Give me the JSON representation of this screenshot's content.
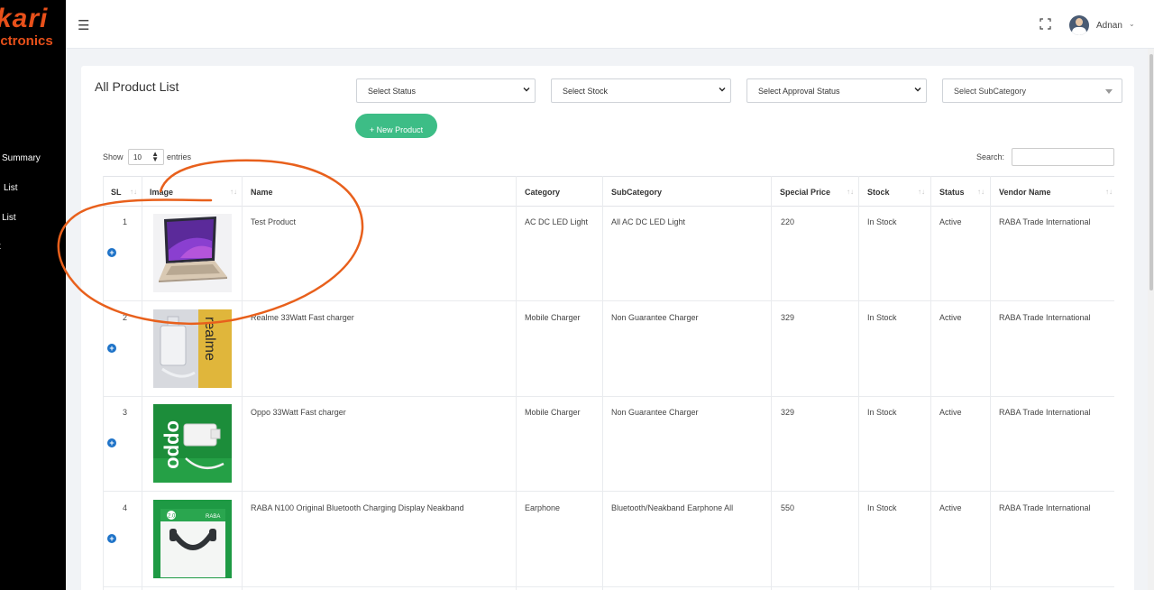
{
  "sidebar": {
    "logo_line1": "kari",
    "logo_line2": "ectronics",
    "items": [
      {
        "label": "Summary"
      },
      {
        "label": "List"
      },
      {
        "label": "r List"
      },
      {
        "label": "t"
      }
    ]
  },
  "topbar": {
    "menu_icon": "hamburger-icon",
    "fullscreen_icon": "fullscreen-icon",
    "user_name": "Adnan",
    "caret": "⌄"
  },
  "page": {
    "title": "All Product List",
    "filters": [
      {
        "label": "Select Status"
      },
      {
        "label": "Select Stock"
      },
      {
        "label": "Select Approval Status"
      },
      {
        "label": "Select SubCategory"
      }
    ],
    "new_button": "+ New Product",
    "show_label": "Show",
    "show_value": "10",
    "entries_label": "entries",
    "search_label": "Search:"
  },
  "table": {
    "headers": [
      "SL",
      "Image",
      "Name",
      "Category",
      "SubCategory",
      "Special Price",
      "Stock",
      "Status",
      "Vendor Name"
    ],
    "rows": [
      {
        "sl": "1",
        "name": "Test Product",
        "category": "AC DC LED Light",
        "subcategory": "All AC DC LED Light",
        "price": "220",
        "stock": "In Stock",
        "status": "Active",
        "vendor": "RABA Trade International",
        "image": "laptop"
      },
      {
        "sl": "2",
        "name": "Realme 33Watt Fast charger",
        "category": "Mobile Charger",
        "subcategory": "Non Guarantee Charger",
        "price": "329",
        "stock": "In Stock",
        "status": "Active",
        "vendor": "RABA Trade International",
        "image": "realme-box"
      },
      {
        "sl": "3",
        "name": "Oppo 33Watt Fast charger",
        "category": "Mobile Charger",
        "subcategory": "Non Guarantee Charger",
        "price": "329",
        "stock": "In Stock",
        "status": "Active",
        "vendor": "RABA Trade International",
        "image": "oppo-box"
      },
      {
        "sl": "4",
        "name": "RABA N100 Original Bluetooth Charging Display Neakband",
        "category": "Earphone",
        "subcategory": "Bluetooth/Neakband Earphone All",
        "price": "550",
        "stock": "In Stock",
        "status": "Active",
        "vendor": "RABA Trade International",
        "image": "neckband-box"
      }
    ]
  },
  "thumb_text": {
    "realme": "realme",
    "oppo": "oppo",
    "raba_badge": "2.0",
    "raba_brand": "RABA"
  },
  "colors": {
    "brand_orange": "#e8501a",
    "sidebar_bg": "#000000",
    "button_green": "#3dbd86",
    "expand_blue": "#1e73c8",
    "annotation": "#e8601c"
  }
}
